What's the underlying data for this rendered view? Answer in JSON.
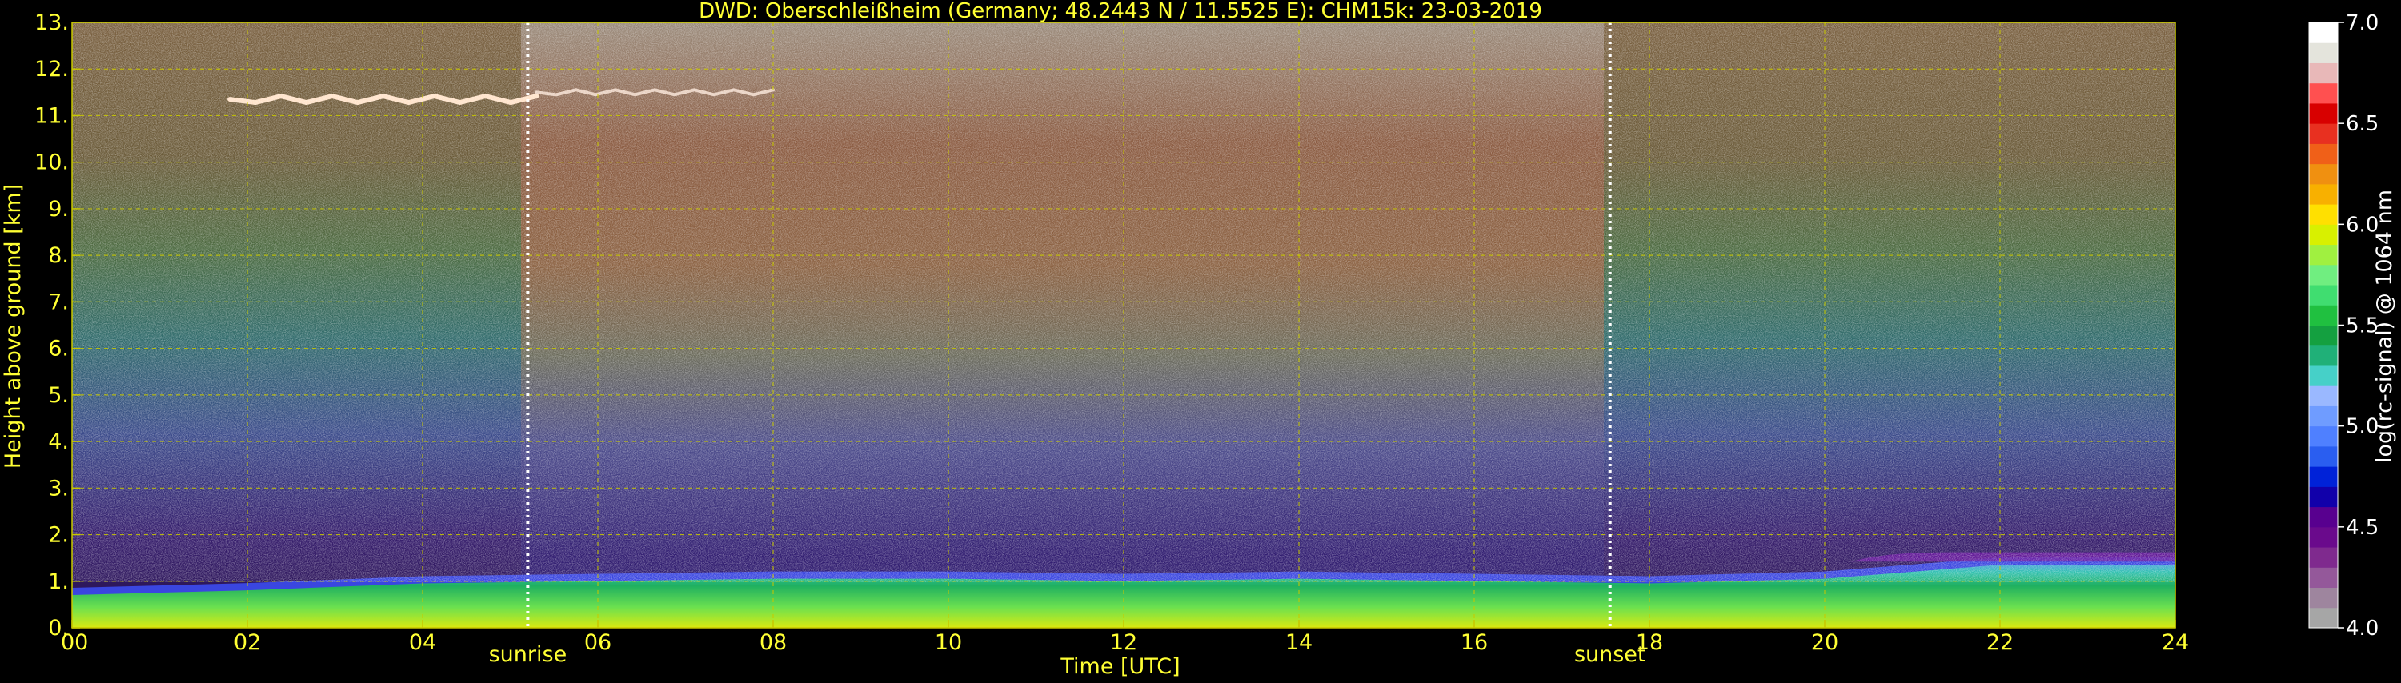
{
  "chart_data": {
    "type": "heatmap",
    "title": "DWD: Oberschleißheim (Germany; 48.2443 N / 11.5525 E):    CHM15k: 23-03-2019",
    "xlabel": "Time [UTC]",
    "ylabel": "Height above ground [km]",
    "x_range": [
      0,
      24
    ],
    "y_range": [
      0,
      13
    ],
    "x_tick_values": [
      0,
      2,
      4,
      6,
      8,
      10,
      12,
      14,
      16,
      18,
      20,
      22,
      24
    ],
    "x_tick_labels": [
      "00",
      "02",
      "04",
      "06",
      "08",
      "10",
      "12",
      "14",
      "16",
      "18",
      "20",
      "22",
      "24"
    ],
    "y_tick_values": [
      0,
      1,
      2,
      3,
      4,
      5,
      6,
      7,
      8,
      9,
      10,
      11,
      12,
      13
    ],
    "y_tick_labels": [
      "0.",
      "1.",
      "2.",
      "3.",
      "4.",
      "5.",
      "6.",
      "7.",
      "8.",
      "9.",
      "10.",
      "11.",
      "12.",
      "13."
    ],
    "grid": true,
    "markers": [
      {
        "label": "sunrise",
        "x": 5.2
      },
      {
        "label": "sunset",
        "x": 17.55
      }
    ],
    "colorbar": {
      "label": "log(rc-signal) @ 1064 nm",
      "range": [
        4.0,
        7.0
      ],
      "tick_values": [
        4.0,
        4.5,
        5.0,
        5.5,
        6.0,
        6.5,
        7.0
      ],
      "tick_labels": [
        "4.0",
        "4.5",
        "5.0",
        "5.5",
        "6.0",
        "6.5",
        "7.0"
      ],
      "colors": [
        "#a6a6a6",
        "#9e859e",
        "#94589a",
        "#7f2a8e",
        "#6a0a8c",
        "#58008f",
        "#1100aa",
        "#0022d8",
        "#2a5ef0",
        "#4f80ff",
        "#6f9cff",
        "#9ab8ff",
        "#46d0c8",
        "#20b078",
        "#14a040",
        "#20c040",
        "#40dd70",
        "#70ee80",
        "#a0f040",
        "#d8f000",
        "#ffe000",
        "#f8b000",
        "#f09010",
        "#f06018",
        "#e83020",
        "#d80000",
        "#ff5050",
        "#e8b8b8",
        "#e4e4dc",
        "#ffffff"
      ],
      "color_stops": [
        4.0,
        4.1,
        4.2,
        4.3,
        4.4,
        4.5,
        4.6,
        4.7,
        4.8,
        4.9,
        5.0,
        5.1,
        5.2,
        5.3,
        5.4,
        5.5,
        5.6,
        5.7,
        5.8,
        5.9,
        6.0,
        6.1,
        6.2,
        6.3,
        6.4,
        6.5,
        6.6,
        6.7,
        6.8,
        6.9
      ]
    },
    "features": [
      {
        "kind": "cirrus",
        "x": [
          1.8,
          5.3
        ],
        "height_km": 11.35
      },
      {
        "kind": "cirrus",
        "x": [
          5.3,
          8.0
        ],
        "height_km": 11.5
      },
      {
        "kind": "boundary_layer_top",
        "x": [
          0,
          24
        ],
        "height_km": [
          0.85,
          0.95,
          1.1,
          1.15,
          1.2,
          1.2,
          1.15,
          1.2,
          1.15,
          1.1,
          1.2,
          1.5,
          1.5
        ]
      }
    ]
  },
  "colors": {
    "text": "#ffff33",
    "grid": "#c8c800",
    "colorbar_text": "#ffffff",
    "background": "#000000",
    "marker": "#ffffff"
  }
}
